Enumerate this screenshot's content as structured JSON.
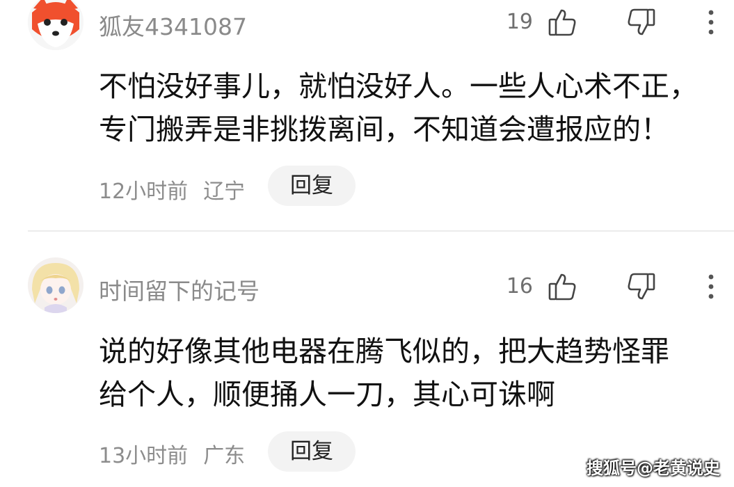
{
  "comments": [
    {
      "username": "狐友4341087",
      "avatar_icon": "fox-avatar-icon",
      "like_count": "19",
      "content_line1": "不怕没好事儿，就怕没好人。一些人心术不正，",
      "content_line2": "专门搬弄是非挑拨离间，不知道会遭报应的！",
      "time": "12小时前",
      "location": "辽宁",
      "reply_label": "回复"
    },
    {
      "username": "时间留下的记号",
      "avatar_icon": "anime-girl-avatar-icon",
      "like_count": "16",
      "content_line1": "说的好像其他电器在腾飞似的，把大趋势怪罪",
      "content_line2": "给个人，顺便捅人一刀，其心可诛啊",
      "time": "13小时前",
      "location": "广东",
      "reply_label": "回复"
    }
  ],
  "icons": {
    "like": "thumbs-up-icon",
    "dislike": "thumbs-down-icon",
    "more": "more-vertical-icon"
  },
  "watermark": "搜狐号@老黄说史",
  "colors": {
    "fox_orange": "#f0502e",
    "text_gray": "#8a8a8a",
    "reply_bg": "#f3f3f3"
  }
}
